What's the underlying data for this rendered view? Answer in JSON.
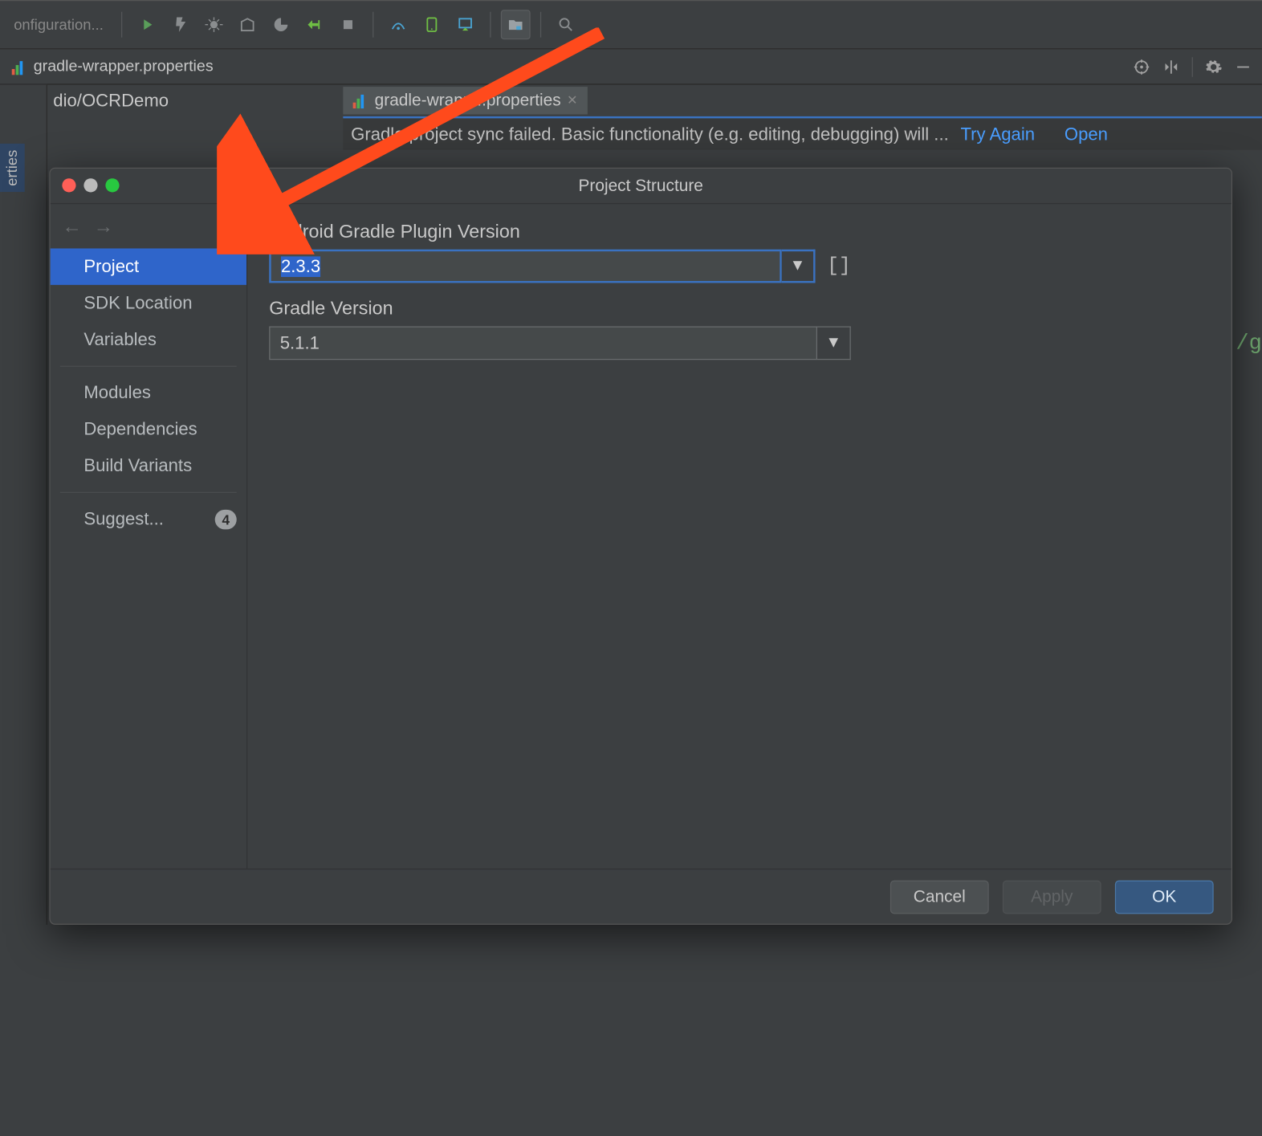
{
  "toolbar": {
    "config_label": "onfiguration..."
  },
  "tab": {
    "filename": "gradle-wrapper.properties"
  },
  "breadcrumb": "dio/OCRDemo",
  "editor_tab": {
    "filename": "gradle-wrapp...properties"
  },
  "sync_bar": {
    "msg": "Gradle project sync failed. Basic functionality (e.g. editing, debugging) will ...",
    "try_again": "Try Again",
    "open": "Open"
  },
  "sidebar_vertical": "erties",
  "code_hint": "/g",
  "dialog": {
    "title": "Project Structure",
    "side": {
      "back": "←",
      "fwd": "→",
      "items": [
        {
          "label": "Project",
          "selected": true
        },
        {
          "label": "SDK Location"
        },
        {
          "label": "Variables"
        }
      ],
      "items2": [
        {
          "label": "Modules"
        },
        {
          "label": "Dependencies"
        },
        {
          "label": "Build Variants"
        }
      ],
      "items3": [
        {
          "label": "Suggest...",
          "badge": "4"
        }
      ]
    },
    "fields": {
      "plugin_label": "Android Gradle Plugin Version",
      "plugin_value": "2.3.3",
      "brackets": "[]",
      "gradle_label": "Gradle Version",
      "gradle_value": "5.1.1"
    },
    "buttons": {
      "cancel": "Cancel",
      "apply": "Apply",
      "ok": "OK"
    }
  }
}
